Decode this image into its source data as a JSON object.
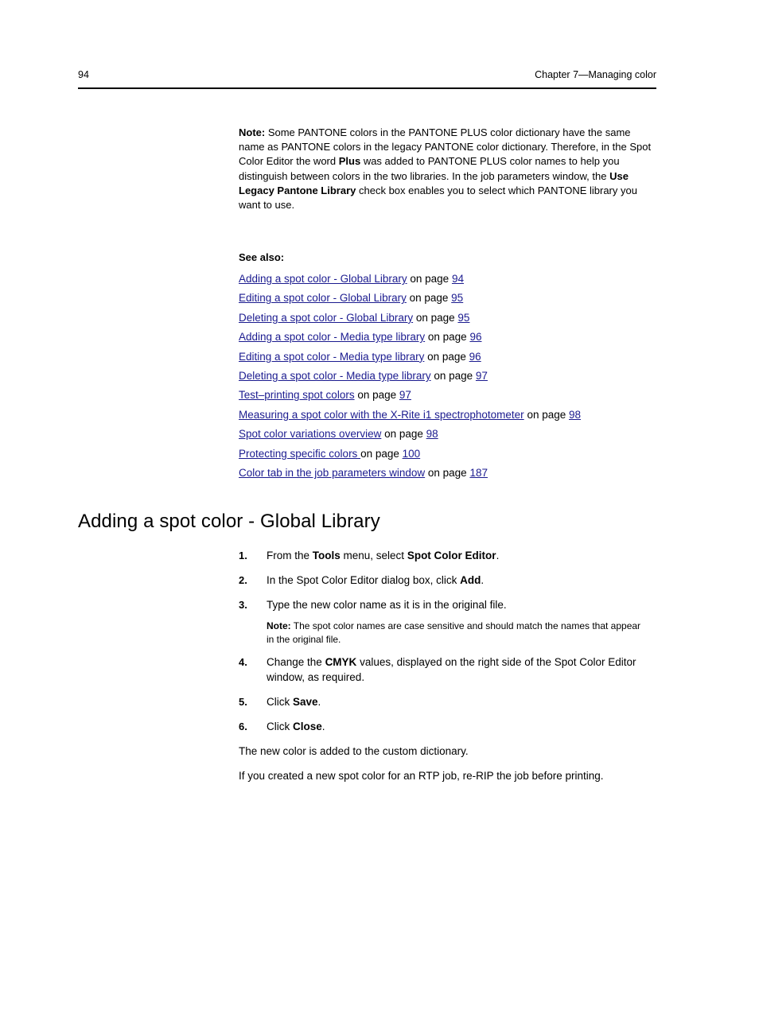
{
  "header": {
    "folio": "94",
    "chapter": "Chapter 7—Managing color"
  },
  "note_intro": {
    "label": "Note:",
    "segments": [
      {
        "text": " Some PANTONE colors in the PANTONE PLUS color dictionary have the same name as PANTONE colors in the legacy PANTONE color dictionary. Therefore, in the Spot Color Editor the word ",
        "bold": false
      },
      {
        "text": "Plus",
        "bold": true
      },
      {
        "text": " was added to PANTONE PLUS color names to help you distinguish between colors in the two libraries. In the job parameters window, the ",
        "bold": false
      },
      {
        "text": "Use Legacy Pantone Library",
        "bold": true
      },
      {
        "text": " check box enables you to select which PANTONE library you want to use.",
        "bold": false
      }
    ]
  },
  "see_also": {
    "title": "See also:",
    "on_page_label": "on page",
    "entries": [
      {
        "link": "Adding a spot color - Global Library",
        "page": "94"
      },
      {
        "link": "Editing a spot color - Global Library",
        "page": "95"
      },
      {
        "link": "Deleting a spot color - Global Library",
        "page": "95"
      },
      {
        "link": "Adding a spot color - Media type library",
        "page": "96"
      },
      {
        "link": "Editing a spot color - Media type library",
        "page": "96"
      },
      {
        "link": "Deleting a spot color - Media type library",
        "page": "97"
      },
      {
        "link": "Test–printing spot colors",
        "page": "97"
      },
      {
        "link": "Measuring a spot color with the X-Rite i1 spectrophotometer",
        "page": "98"
      },
      {
        "link": "Spot color variations overview",
        "page": "98"
      },
      {
        "link": "Protecting specific colors ",
        "page": "100"
      },
      {
        "link": "Color tab in the job parameters window",
        "page": "187"
      }
    ]
  },
  "section": {
    "title": "Adding a spot color - Global Library",
    "steps": [
      {
        "num": "1.",
        "segments": [
          {
            "text": "From the ",
            "bold": false
          },
          {
            "text": "Tools",
            "bold": true
          },
          {
            "text": " menu, select ",
            "bold": false
          },
          {
            "text": "Spot Color Editor",
            "bold": true
          },
          {
            "text": ".",
            "bold": false
          }
        ]
      },
      {
        "num": "2.",
        "segments": [
          {
            "text": "In the Spot Color Editor dialog box, click ",
            "bold": false
          },
          {
            "text": "Add",
            "bold": true
          },
          {
            "text": ".",
            "bold": false
          }
        ]
      },
      {
        "num": "3.",
        "segments": [
          {
            "text": "Type the new color name as it is in the original file.",
            "bold": false
          }
        ]
      },
      {
        "num": "4.",
        "segments": [
          {
            "text": "Change the ",
            "bold": false
          },
          {
            "text": "CMYK",
            "bold": true
          },
          {
            "text": " values, displayed on the right side of the Spot Color Editor window, as required.",
            "bold": false
          }
        ]
      },
      {
        "num": "5.",
        "segments": [
          {
            "text": "Click ",
            "bold": false
          },
          {
            "text": "Save",
            "bold": true
          },
          {
            "text": ".",
            "bold": false
          }
        ]
      },
      {
        "num": "6.",
        "segments": [
          {
            "text": "Click ",
            "bold": false
          },
          {
            "text": "Close",
            "bold": true
          },
          {
            "text": ".",
            "bold": false
          }
        ]
      }
    ],
    "step3_note": {
      "label": "Note:",
      "text": " The spot color names are case sensitive and should match the names that appear in the original file."
    },
    "closing_paragraphs": [
      "The new color is added to the custom dictionary.",
      "If you created a new spot color for an RTP job, re-RIP the job before printing."
    ]
  },
  "colors": {
    "link": "#1b1b8f",
    "text": "#000000",
    "background": "#ffffff"
  }
}
